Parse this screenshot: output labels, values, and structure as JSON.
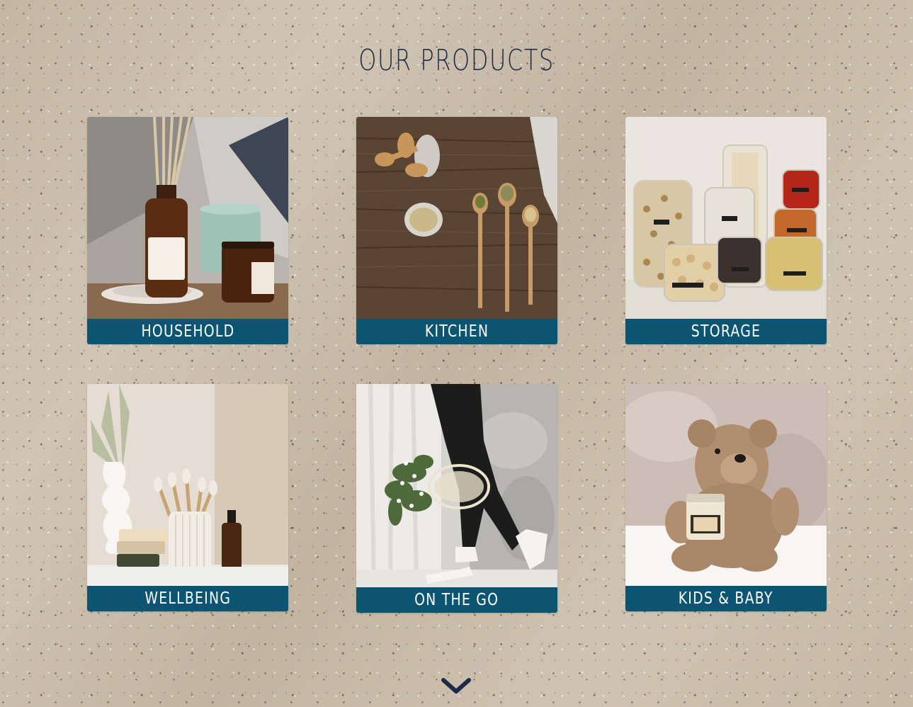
{
  "page": {
    "title": "OUR PRODUCTS"
  },
  "categories": [
    {
      "id": "household",
      "label": "HOUSEHOLD"
    },
    {
      "id": "kitchen",
      "label": "KITCHEN"
    },
    {
      "id": "storage",
      "label": "STORAGE"
    },
    {
      "id": "wellbeing",
      "label": "WELLBEING"
    },
    {
      "id": "onthego",
      "label": "ON THE GO"
    },
    {
      "id": "kids",
      "label": "KIDS & BABY"
    }
  ],
  "scroll_indicator": {
    "icon": "chevron-down-icon"
  },
  "colors": {
    "title": "#1b2c49",
    "label_bar": "#0b5573",
    "label_text": "#ffffff",
    "background": "#c9bcaa"
  }
}
